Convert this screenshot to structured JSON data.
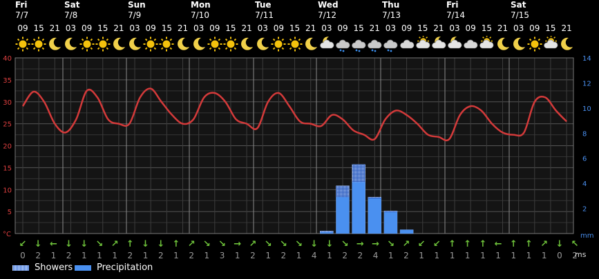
{
  "days": [
    {
      "name": "Fri",
      "date": "7/7"
    },
    {
      "name": "Sat",
      "date": "7/8"
    },
    {
      "name": "Sun",
      "date": "7/9"
    },
    {
      "name": "Mon",
      "date": "7/10"
    },
    {
      "name": "Tue",
      "date": "7/11"
    },
    {
      "name": "Wed",
      "date": "7/12"
    },
    {
      "name": "Thu",
      "date": "7/13"
    },
    {
      "name": "Fri",
      "date": "7/14"
    },
    {
      "name": "Sat",
      "date": "7/15"
    }
  ],
  "hours": [
    "09",
    "15",
    "21",
    "03",
    "09",
    "15",
    "21",
    "03",
    "09",
    "15",
    "21",
    "03",
    "09",
    "15",
    "21",
    "03",
    "09",
    "15",
    "21",
    "03",
    "09",
    "15",
    "21",
    "03",
    "09",
    "15",
    "21",
    "03",
    "09",
    "15",
    "21",
    "03",
    "09",
    "15",
    "21"
  ],
  "weather_icons": [
    "sun-icon",
    "sun-icon",
    "moon-icon",
    "moon-icon",
    "sun-icon",
    "sun-icon",
    "moon-icon",
    "moon-icon",
    "sun-icon",
    "sun-icon",
    "moon-icon",
    "moon-icon",
    "sun-icon",
    "sun-icon",
    "moon-icon",
    "moon-icon",
    "sun-icon",
    "sun-icon",
    "moon-icon",
    "moon-cloud-icon",
    "rain-cloud-icon",
    "rain-cloud-icon",
    "rain-cloud-icon",
    "rain-cloud-icon",
    "cloud-icon",
    "sun-cloud-icon",
    "moon-cloud-icon",
    "moon-cloud-icon",
    "cloud-icon",
    "sun-cloud-icon",
    "moon-icon",
    "moon-icon",
    "sun-icon",
    "sun-cloud-icon",
    "moon-icon"
  ],
  "wind": {
    "arrows": [
      "↙",
      "↓",
      "←",
      "↓",
      "↓",
      "↘",
      "↗",
      "↑",
      "↓",
      "↓",
      "↑",
      "↗",
      "↘",
      "↘",
      "→",
      "↗",
      "↘",
      "↘",
      "↘",
      "↓",
      "↓",
      "↘",
      "→",
      "→",
      "↘",
      "↗",
      "↙",
      "↙",
      "↑",
      "↑",
      "↑",
      "←",
      "↑",
      "↑",
      "↗",
      "↓",
      "↖"
    ],
    "speeds": [
      "0",
      "2",
      "1",
      "2",
      "1",
      "1",
      "1",
      "2",
      "1",
      "2",
      "1",
      "2",
      "1",
      "3",
      "1",
      "2",
      "1",
      "2",
      "1",
      "4",
      "1",
      "2",
      "2",
      "4",
      "1",
      "2",
      "1",
      "1",
      "1",
      "1",
      "1",
      "1",
      "1",
      "1",
      "1",
      "0",
      "2",
      "2"
    ],
    "unit": "ms"
  },
  "legend": [
    {
      "label": "Showers"
    },
    {
      "label": "Precipitation"
    }
  ],
  "colors": {
    "temperature": "#d43a3a",
    "precipitation": "#4a90f0",
    "wind": "#6ec23a",
    "grid": "#555555",
    "left_axis": "#e04040",
    "right_axis": "#4a90f0"
  },
  "chart_data": {
    "type": "line",
    "x_labels": [
      "09",
      "15",
      "21",
      "03",
      "09",
      "15",
      "21",
      "03",
      "09",
      "15",
      "21",
      "03",
      "09",
      "15",
      "21",
      "03",
      "09",
      "15",
      "21",
      "03",
      "09",
      "15",
      "21",
      "03",
      "09",
      "15",
      "21",
      "03",
      "09",
      "15",
      "21",
      "03",
      "09",
      "15",
      "21"
    ],
    "series": [
      {
        "values": [
          29,
          32.3,
          30,
          25,
          23,
          26,
          32.5,
          31,
          26,
          25,
          25,
          31,
          33,
          30,
          27,
          25,
          26,
          31,
          32,
          30,
          26,
          25,
          24,
          30,
          32,
          29,
          25.5,
          25,
          24.5,
          27,
          26,
          23.5,
          22.5,
          21.5,
          26,
          28,
          27,
          25,
          22.5,
          22,
          21.5,
          27,
          29,
          28,
          25,
          23,
          22.5,
          23,
          30,
          31,
          28,
          25.5
        ]
      },
      {
        "name": "Showers",
        "unit": "mm",
        "x_labels": [
          "03",
          "09",
          "15",
          "21",
          "03",
          "09"
        ],
        "values": [
          0.2,
          3.8,
          5.5,
          2.9,
          1.8,
          0.3
        ]
      },
      {
        "name": "Precipitation",
        "unit": "mm",
        "x_labels": [
          "03",
          "09",
          "15",
          "21",
          "03",
          "09"
        ],
        "values": [
          0.1,
          2.9,
          4.1,
          2.8,
          1.7,
          0.3
        ]
      }
    ],
    "y_left": {
      "unit": "°C",
      "ticks": [
        "40",
        "35",
        "30",
        "25",
        "20",
        "15",
        "10",
        "5"
      ],
      "min": 0,
      "max": 40
    },
    "y_right": {
      "unit": "mm",
      "ticks": [
        "14",
        "12",
        "10",
        "8",
        "6",
        "4",
        "2"
      ],
      "min": 0,
      "max": 14
    },
    "grid": true
  }
}
